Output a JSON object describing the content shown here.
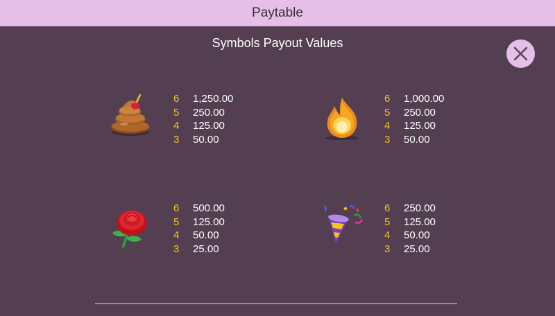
{
  "header": {
    "title": "Paytable"
  },
  "subtitle": "Symbols Payout Values",
  "close_icon": "close-icon",
  "colors": {
    "background": "#533f51",
    "header": "#e6bfe9",
    "count": "#f2c21b",
    "value": "#ffffff"
  },
  "symbols": [
    {
      "icon": "poop-icon",
      "pays": [
        {
          "count": "6",
          "value": "1,250.00"
        },
        {
          "count": "5",
          "value": "250.00"
        },
        {
          "count": "4",
          "value": "125.00"
        },
        {
          "count": "3",
          "value": "50.00"
        }
      ]
    },
    {
      "icon": "fire-icon",
      "pays": [
        {
          "count": "6",
          "value": "1,000.00"
        },
        {
          "count": "5",
          "value": "250.00"
        },
        {
          "count": "4",
          "value": "125.00"
        },
        {
          "count": "3",
          "value": "50.00"
        }
      ]
    },
    {
      "icon": "rose-icon",
      "pays": [
        {
          "count": "6",
          "value": "500.00"
        },
        {
          "count": "5",
          "value": "125.00"
        },
        {
          "count": "4",
          "value": "50.00"
        },
        {
          "count": "3",
          "value": "25.00"
        }
      ]
    },
    {
      "icon": "party-popper-icon",
      "pays": [
        {
          "count": "6",
          "value": "250.00"
        },
        {
          "count": "5",
          "value": "125.00"
        },
        {
          "count": "4",
          "value": "50.00"
        },
        {
          "count": "3",
          "value": "25.00"
        }
      ]
    }
  ]
}
